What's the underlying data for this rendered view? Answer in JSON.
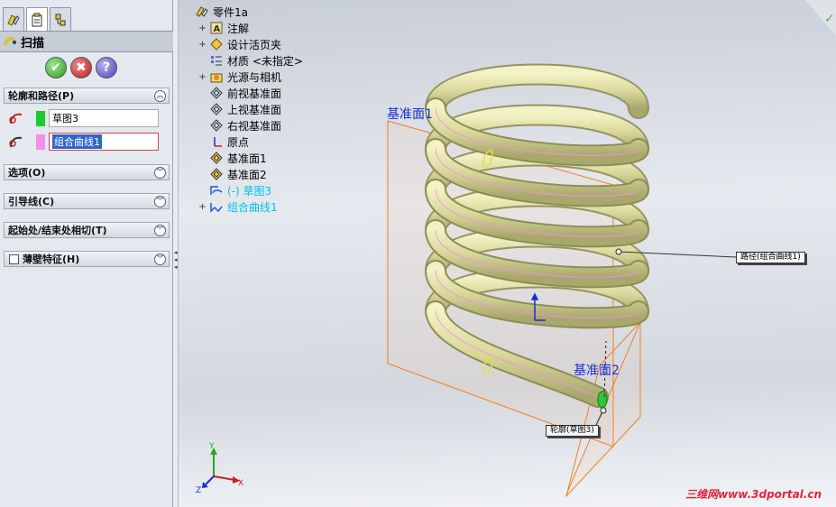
{
  "property_manager": {
    "title": "扫描",
    "tabs": [
      "feature-manager-icon",
      "property-manager-icon",
      "configuration-manager-icon"
    ],
    "buttons": {
      "ok": "✔",
      "cancel": "✖",
      "help": "?"
    },
    "groups": {
      "profile_path": "轮廓和路径(P)",
      "options": "选项(O)",
      "guides": "引导线(C)",
      "start_end": "起始处/结束处相切(T)",
      "thin": "薄壁特征(H)"
    },
    "profile_value": "草图3",
    "path_value": "组合曲线1",
    "colors": {
      "profile_swatch": "#1ec832",
      "path_swatch": "#f48ee8"
    }
  },
  "tree": {
    "items": [
      {
        "label": "零件1a",
        "icon": "part-icon",
        "expand": ""
      },
      {
        "label": "注解",
        "icon": "annotation-icon",
        "expand": "+"
      },
      {
        "label": "设计活页夹",
        "icon": "binder-icon",
        "expand": "+"
      },
      {
        "label": "材质 <未指定>",
        "icon": "material-icon",
        "expand": ""
      },
      {
        "label": "光源与相机",
        "icon": "lights-icon",
        "expand": "+"
      },
      {
        "label": "前视基准面",
        "icon": "plane-icon",
        "expand": ""
      },
      {
        "label": "上视基准面",
        "icon": "plane-icon",
        "expand": ""
      },
      {
        "label": "右视基准面",
        "icon": "plane-icon",
        "expand": ""
      },
      {
        "label": "原点",
        "icon": "origin-icon",
        "expand": ""
      },
      {
        "label": "基准面1",
        "icon": "plane-icon",
        "expand": ""
      },
      {
        "label": "基准面2",
        "icon": "plane-icon",
        "expand": ""
      },
      {
        "label": "(-) 草图3",
        "icon": "sketch-icon",
        "expand": ""
      },
      {
        "label": "组合曲线1",
        "icon": "composite-curve-icon",
        "expand": "+"
      }
    ]
  },
  "viewport": {
    "plane1_label": "基准面1",
    "plane2_label": "基准面2",
    "path_callout": "路径(组合曲线1)",
    "profile_callout": "轮廓(草图3)",
    "triad": {
      "x": "X",
      "y": "Y",
      "z": "Z"
    },
    "watermark_cn": "三维网",
    "watermark_en": "www.3dportal.cn"
  }
}
